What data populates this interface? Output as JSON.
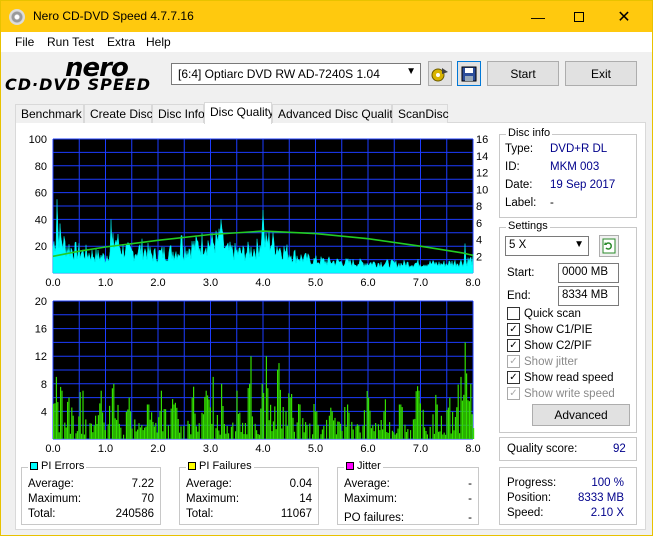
{
  "window": {
    "title": "Nero CD-DVD Speed 4.7.7.16"
  },
  "menu": [
    "File",
    "Run Test",
    "Extra",
    "Help"
  ],
  "logo": {
    "brand": "nero",
    "product": "CD·DVD SPEED"
  },
  "drive": {
    "selected": "[6:4]   Optiarc DVD RW AD-7240S 1.04"
  },
  "toolbar": {
    "start": "Start",
    "exit": "Exit"
  },
  "tabs": [
    "Benchmark",
    "Create Disc",
    "Disc Info",
    "Disc Quality",
    "Advanced Disc Quality",
    "ScanDisc"
  ],
  "active_tab": "Disc Quality",
  "disc_info": {
    "title": "Disc info",
    "type_label": "Type:",
    "type": "DVD+R DL",
    "id_label": "ID:",
    "id": "MKM 003",
    "date_label": "Date:",
    "date": "19 Sep 2017",
    "label_label": "Label:",
    "label": "-"
  },
  "settings": {
    "title": "Settings",
    "speed": "5 X",
    "start_label": "Start:",
    "start": "0000 MB",
    "end_label": "End:",
    "end": "8334 MB",
    "quick_scan": "Quick scan",
    "show_c1pie": "Show C1/PIE",
    "show_c2pif": "Show C2/PIF",
    "show_jitter": "Show jitter",
    "show_read_speed": "Show read speed",
    "show_write_speed": "Show write speed",
    "advanced": "Advanced"
  },
  "quality": {
    "label": "Quality score:",
    "value": "92"
  },
  "progress": {
    "progress_label": "Progress:",
    "progress": "100 %",
    "position_label": "Position:",
    "position": "8333 MB",
    "speed_label": "Speed:",
    "speed": "2.10 X"
  },
  "pi_errors": {
    "title": "PI Errors",
    "avg_label": "Average:",
    "avg": "7.22",
    "max_label": "Maximum:",
    "max": "70",
    "total_label": "Total:",
    "total": "240586",
    "color": "#00ffff"
  },
  "pi_failures": {
    "title": "PI Failures",
    "avg_label": "Average:",
    "avg": "0.04",
    "max_label": "Maximum:",
    "max": "14",
    "total_label": "Total:",
    "total": "11067",
    "color": "#ffff00"
  },
  "jitter": {
    "title": "Jitter",
    "avg_label": "Average:",
    "avg": "-",
    "max_label": "Maximum:",
    "max": "-",
    "po_label": "PO failures:",
    "po": "-",
    "color": "#ff00ff"
  },
  "chart_data": [
    {
      "type": "area",
      "series": [
        {
          "name": "PI Errors"
        },
        {
          "name": "Read speed"
        }
      ],
      "x_ticks": [
        "0.0",
        "1.0",
        "2.0",
        "3.0",
        "4.0",
        "5.0",
        "6.0",
        "7.0",
        "8.0"
      ],
      "y_ticks_left": [
        "20",
        "40",
        "60",
        "80",
        "100"
      ],
      "y_ticks_right": [
        "2",
        "4",
        "6",
        "8",
        "10",
        "12",
        "14",
        "16"
      ],
      "xlim": [
        0,
        8
      ],
      "ylim": [
        0,
        100
      ],
      "y2lim": [
        0,
        16
      ],
      "pi_profile": [
        [
          0,
          24
        ],
        [
          0.1,
          40
        ],
        [
          0.15,
          30
        ],
        [
          0.25,
          24
        ],
        [
          0.4,
          20
        ],
        [
          0.6,
          18
        ],
        [
          0.8,
          16
        ],
        [
          1.0,
          14
        ],
        [
          1.2,
          30
        ],
        [
          1.3,
          22
        ],
        [
          1.5,
          18
        ],
        [
          1.7,
          22
        ],
        [
          1.9,
          16
        ],
        [
          2.1,
          18
        ],
        [
          2.4,
          20
        ],
        [
          2.7,
          24
        ],
        [
          2.9,
          28
        ],
        [
          3.0,
          26
        ],
        [
          3.2,
          30
        ],
        [
          3.3,
          20
        ],
        [
          3.6,
          18
        ],
        [
          3.9,
          22
        ],
        [
          4.0,
          36
        ],
        [
          4.05,
          26
        ],
        [
          4.1,
          30
        ],
        [
          4.4,
          20
        ],
        [
          4.7,
          14
        ],
        [
          5.0,
          11
        ],
        [
          5.4,
          10
        ],
        [
          5.8,
          9
        ],
        [
          6.2,
          9
        ],
        [
          6.6,
          8
        ],
        [
          7.0,
          9
        ],
        [
          7.4,
          8
        ],
        [
          7.8,
          10
        ],
        [
          8.0,
          12
        ]
      ],
      "pi_spikes": [
        [
          0.08,
          55
        ],
        [
          1.1,
          40
        ],
        [
          2.45,
          28
        ],
        [
          3.2,
          40
        ],
        [
          4.0,
          47
        ],
        [
          7.85,
          22
        ]
      ],
      "speed_curve": [
        [
          0,
          2.0
        ],
        [
          0.5,
          2.6
        ],
        [
          1,
          3.1
        ],
        [
          2,
          3.9
        ],
        [
          3,
          4.6
        ],
        [
          4,
          5.0
        ],
        [
          5,
          4.7
        ],
        [
          6,
          4.1
        ],
        [
          7,
          3.2
        ],
        [
          7.8,
          2.4
        ],
        [
          8,
          2.1
        ]
      ]
    },
    {
      "type": "bar",
      "series": [
        {
          "name": "PI Failures"
        }
      ],
      "x_ticks": [
        "0.0",
        "1.0",
        "2.0",
        "3.0",
        "4.0",
        "5.0",
        "6.0",
        "7.0",
        "8.0"
      ],
      "y_ticks_left": [
        "4",
        "8",
        "12",
        "16",
        "20"
      ],
      "xlim": [
        0,
        8
      ],
      "ylim": [
        0,
        20
      ],
      "pif_peaks": [
        [
          0.06,
          9
        ],
        [
          0.15,
          7
        ],
        [
          0.3,
          6
        ],
        [
          0.55,
          7
        ],
        [
          0.9,
          7
        ],
        [
          1.15,
          8
        ],
        [
          1.45,
          6
        ],
        [
          1.8,
          5
        ],
        [
          2.05,
          7
        ],
        [
          2.3,
          5
        ],
        [
          2.65,
          6
        ],
        [
          2.9,
          7
        ],
        [
          3.05,
          9
        ],
        [
          3.2,
          8
        ],
        [
          3.5,
          7
        ],
        [
          3.75,
          12
        ],
        [
          3.98,
          8
        ],
        [
          4.05,
          12
        ],
        [
          4.3,
          11
        ],
        [
          4.5,
          6
        ],
        [
          4.7,
          5
        ],
        [
          5.0,
          4
        ],
        [
          5.3,
          4
        ],
        [
          5.6,
          5
        ],
        [
          6.0,
          6
        ],
        [
          6.3,
          4
        ],
        [
          6.6,
          5
        ],
        [
          6.95,
          7
        ],
        [
          7.3,
          5
        ],
        [
          7.55,
          6
        ],
        [
          7.75,
          9
        ],
        [
          7.85,
          14
        ],
        [
          7.95,
          8
        ]
      ]
    }
  ]
}
